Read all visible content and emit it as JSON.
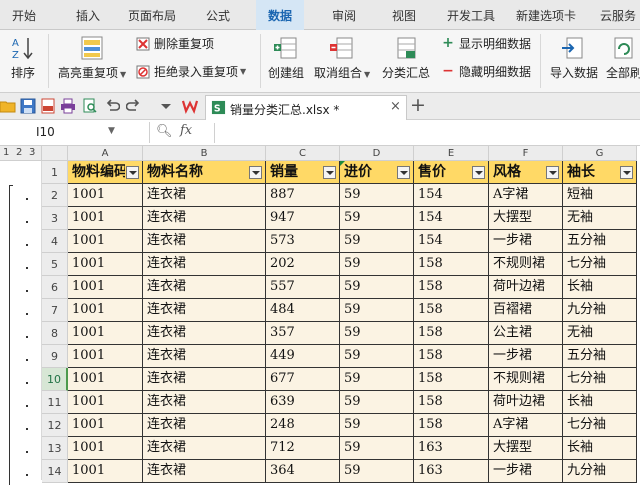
{
  "menu": {
    "items": [
      "开始",
      "插入",
      "页面布局",
      "公式",
      "数据",
      "审阅",
      "视图",
      "开发工具",
      "新建选项卡",
      "云服务"
    ],
    "active_index": 4
  },
  "ribbon": {
    "sort_label": "排序",
    "highlight_dup_label": "高亮重复项",
    "delete_dup_label": "删除重复项",
    "reject_dup_label": "拒绝录入重复项",
    "group_label": "创建组",
    "ungroup_label": "取消组合",
    "subtotal_label": "分类汇总",
    "show_detail_label": "显示明细数据",
    "hide_detail_label": "隐藏明细数据",
    "import_label": "导入数据",
    "refresh_all_label": "全部刷"
  },
  "tabbar": {
    "file_name": "销量分类汇总.xlsx *",
    "close_glyph": "×",
    "new_tab_glyph": "+"
  },
  "formula_bar": {
    "name_box": "I10",
    "fx_label": "fx",
    "content": ""
  },
  "outline": {
    "levels": [
      "1",
      "2",
      "3"
    ]
  },
  "grid": {
    "columns": [
      "A",
      "B",
      "C",
      "D",
      "E",
      "F",
      "G"
    ],
    "row_numbers": [
      "1",
      "2",
      "3",
      "4",
      "5",
      "6",
      "7",
      "8",
      "9",
      "10",
      "11",
      "12",
      "13",
      "14"
    ],
    "selected_row": "10",
    "headers": [
      "物料编码",
      "物料名称",
      "销量",
      "进价",
      "售价",
      "风格",
      "袖长"
    ],
    "rows": [
      [
        "1001",
        "连衣裙",
        "887",
        "59",
        "154",
        "A字裙",
        "短袖"
      ],
      [
        "1001",
        "连衣裙",
        "947",
        "59",
        "154",
        "大摆型",
        "无袖"
      ],
      [
        "1001",
        "连衣裙",
        "573",
        "59",
        "154",
        "一步裙",
        "五分袖"
      ],
      [
        "1001",
        "连衣裙",
        "202",
        "59",
        "158",
        "不规则裙",
        "七分袖"
      ],
      [
        "1001",
        "连衣裙",
        "557",
        "59",
        "158",
        "荷叶边裙",
        "长袖"
      ],
      [
        "1001",
        "连衣裙",
        "484",
        "59",
        "158",
        "百褶裙",
        "九分袖"
      ],
      [
        "1001",
        "连衣裙",
        "357",
        "59",
        "158",
        "公主裙",
        "无袖"
      ],
      [
        "1001",
        "连衣裙",
        "449",
        "59",
        "158",
        "一步裙",
        "五分袖"
      ],
      [
        "1001",
        "连衣裙",
        "677",
        "59",
        "158",
        "不规则裙",
        "七分袖"
      ],
      [
        "1001",
        "连衣裙",
        "639",
        "59",
        "158",
        "荷叶边裙",
        "长袖"
      ],
      [
        "1001",
        "连衣裙",
        "248",
        "59",
        "158",
        "A字裙",
        "七分袖"
      ],
      [
        "1001",
        "连衣裙",
        "712",
        "59",
        "163",
        "大摆型",
        "长袖"
      ],
      [
        "1001",
        "连衣裙",
        "364",
        "59",
        "163",
        "一步裙",
        "九分袖"
      ]
    ]
  }
}
